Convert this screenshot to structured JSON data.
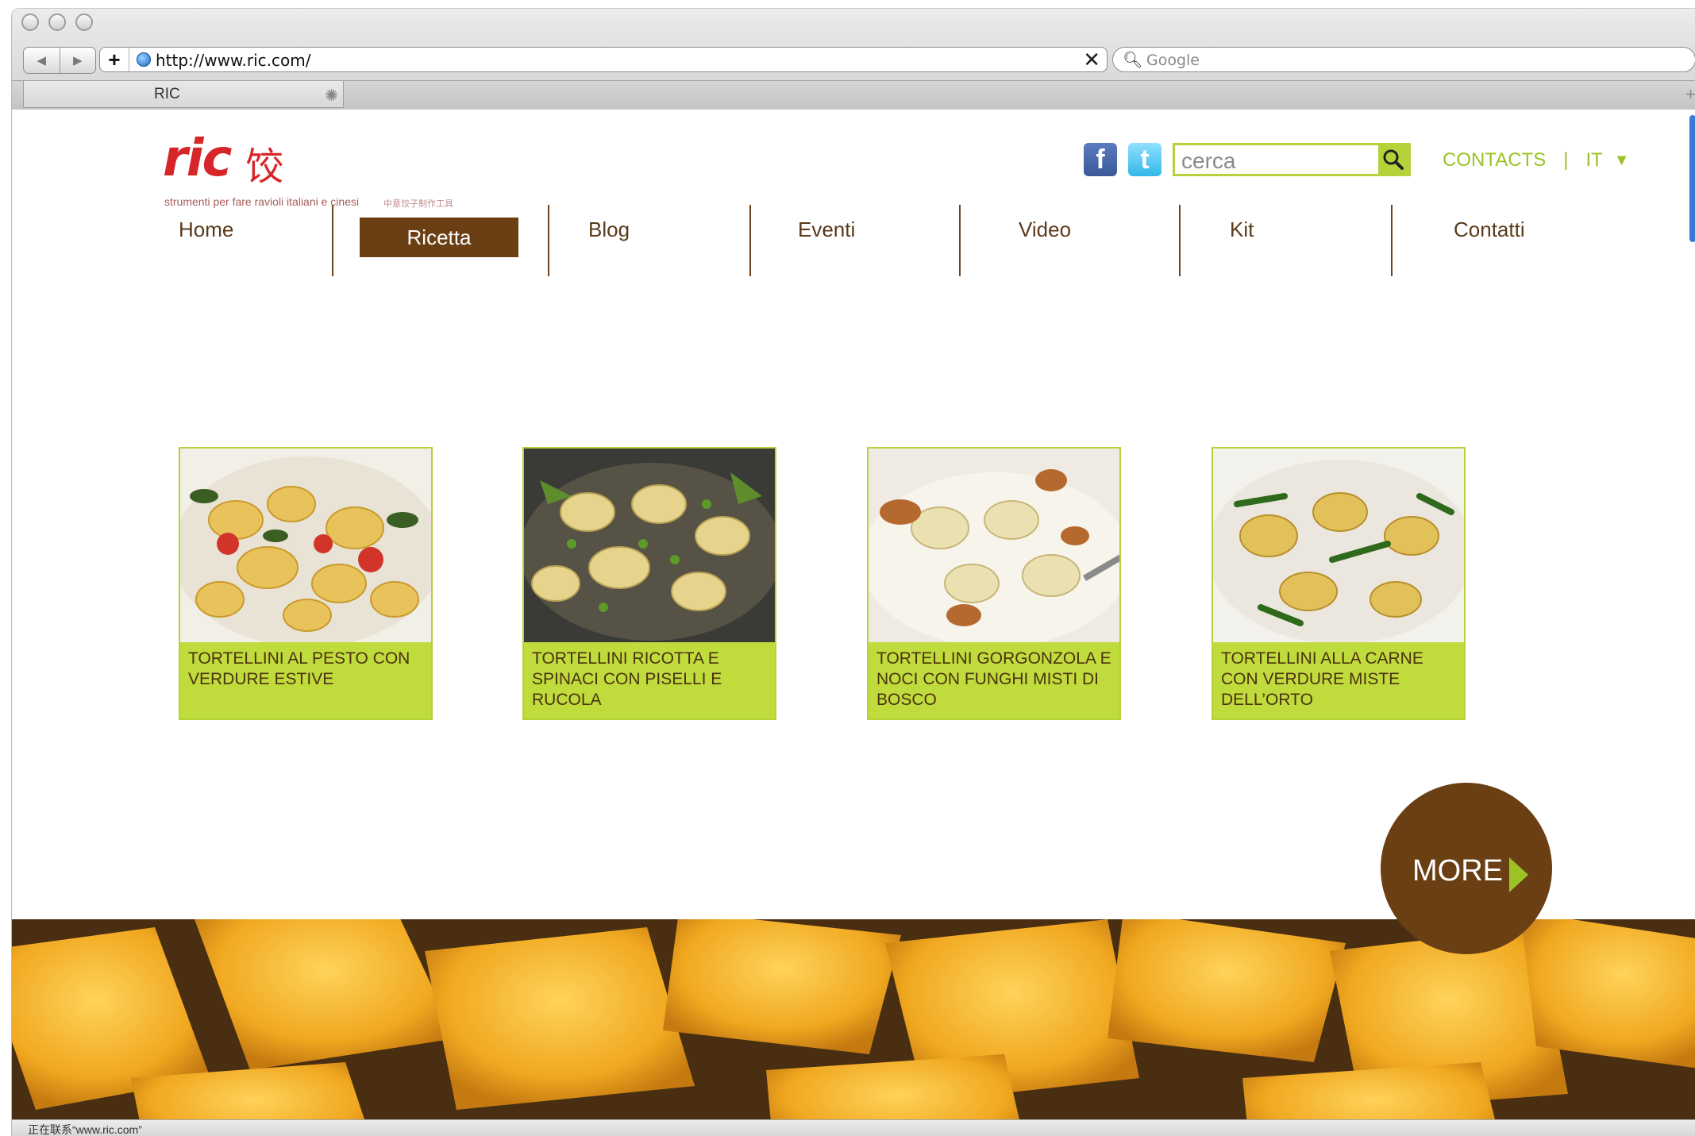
{
  "browser": {
    "url": "http://www.ric.com/",
    "search_placeholder": "Google",
    "tab_title": "RIC",
    "status_text": "正在联系“www.ric.com”"
  },
  "site": {
    "logo_text": "ric",
    "logo_chinese": "饺",
    "tagline": "strumenti per fare ravioli italiani e cinesi",
    "tagline_chinese": "中意饺子制作工具",
    "search_value": "cerca",
    "contacts_link": "CONTACTS",
    "lang_label": "IT"
  },
  "menu": {
    "items": [
      {
        "label": "Home"
      },
      {
        "label": "Ricetta"
      },
      {
        "label": "Blog"
      },
      {
        "label": "Eventi"
      },
      {
        "label": "Video"
      },
      {
        "label": "Kit"
      },
      {
        "label": "Contatti"
      }
    ]
  },
  "recipes": [
    {
      "caption": "TORTELLINI AL PESTO CON VERDURE ESTIVE"
    },
    {
      "caption": "TORTELLINI RICOTTA E SPINACI CON PISELLI E RUCOLA"
    },
    {
      "caption": "TORTELLINI GORGONZOLA E NOCI CON FUNGHI MISTI DI BOSCO"
    },
    {
      "caption": "TORTELLINI ALLA CARNE CON VERDURE MISTE DELL’ORTO"
    }
  ],
  "more_button": {
    "label": "MORE"
  },
  "colors": {
    "brand_red": "#d6262a",
    "accent_green": "#b5d23a",
    "brown": "#6b3f14"
  }
}
